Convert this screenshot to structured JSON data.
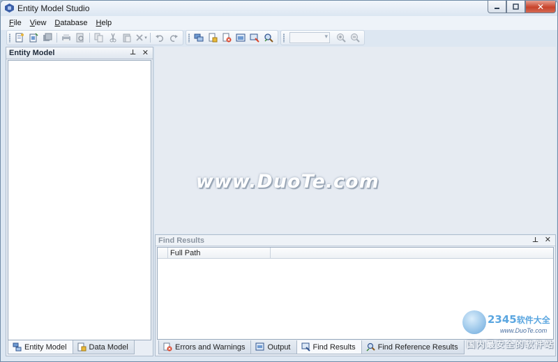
{
  "window": {
    "title": "Entity Model Studio",
    "minimize_icon": "minimize-icon",
    "maximize_icon": "maximize-icon",
    "close_glyph": "✕"
  },
  "menu": [
    {
      "label": "File",
      "mnemonic": "F",
      "rest": "ile"
    },
    {
      "label": "View",
      "mnemonic": "V",
      "rest": "iew"
    },
    {
      "label": "Database",
      "mnemonic": "D",
      "rest": "atabase"
    },
    {
      "label": "Help",
      "mnemonic": "H",
      "rest": "elp"
    }
  ],
  "toolbar": {
    "groups": [
      [
        "new-project-icon",
        "open-project-icon",
        "save-all-icon",
        "sep",
        "print-icon",
        "print-preview-icon",
        "sep",
        "copy-icon",
        "cut-icon",
        "paste-icon",
        "delete-icon",
        "sep",
        "undo-icon",
        "redo-icon"
      ],
      [
        "add-entity-icon",
        "add-relation-icon",
        "validate-icon",
        "properties-icon",
        "generate-icon",
        "find-icon"
      ],
      [
        "zoom-combo",
        "zoom-in-icon",
        "zoom-out-icon"
      ]
    ],
    "zoom_value": ""
  },
  "left_panel": {
    "title": "Entity Model",
    "pin_glyph": "⊥",
    "close_glyph": "✕",
    "tabs": [
      {
        "label": "Entity Model",
        "icon": "entity-model-icon",
        "active": true
      },
      {
        "label": "Data Model",
        "icon": "data-model-icon",
        "active": false
      }
    ]
  },
  "watermark": "www.DuoTe.com",
  "find_panel": {
    "title": "Find Results",
    "pin_glyph": "⊥",
    "close_glyph": "✕",
    "columns": [
      "Full Path",
      ""
    ],
    "tabs": [
      {
        "label": "Errors and Warnings",
        "icon": "errors-warnings-icon",
        "active": false
      },
      {
        "label": "Output",
        "icon": "output-icon",
        "active": false
      },
      {
        "label": "Find Results",
        "icon": "find-results-icon",
        "active": true
      },
      {
        "label": "Find Reference Results",
        "icon": "find-reference-icon",
        "active": false
      }
    ]
  },
  "branding": {
    "logo_number": "2345",
    "logo_text": "软件大全",
    "url": "www.DuoTe.com",
    "slogan": "国内最安全的软件站"
  },
  "colors": {
    "accent": "#3b5fa8",
    "close_button": "#c7432b",
    "panel_border": "#aebccc",
    "workspace": "#e6ebf2"
  }
}
